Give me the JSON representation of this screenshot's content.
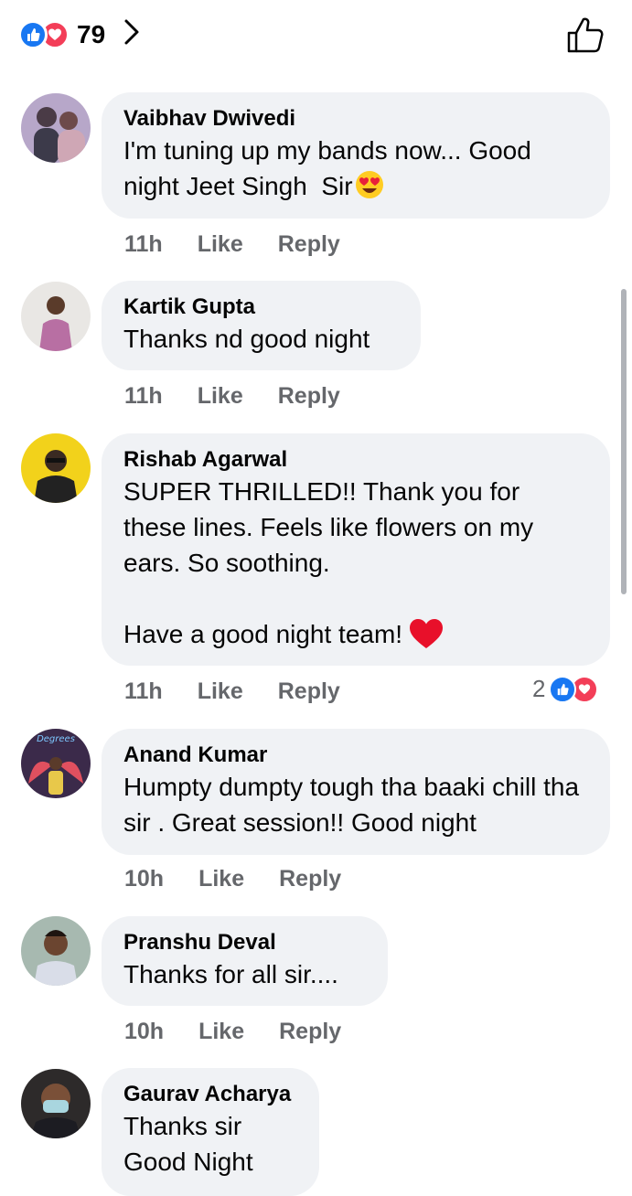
{
  "header": {
    "reaction_count": "79",
    "reaction_icons": [
      "like-icon",
      "love-icon"
    ]
  },
  "comments": [
    {
      "author": "Vaibhav Dwivedi",
      "text": "I'm tuning up my bands now... Good night Jeet Singh  Sir",
      "emoji": "heart-eyes-emoji",
      "time": "11h",
      "like": "Like",
      "reply": "Reply"
    },
    {
      "author": "Kartik Gupta",
      "text": "Thanks nd good night",
      "time": "11h",
      "like": "Like",
      "reply": "Reply"
    },
    {
      "author": "Rishab Agarwal",
      "text": "SUPER THRILLED!! Thank you for these lines. Feels like flowers on my ears. So soothing.\n\nHave a good night team!",
      "emoji": "red-heart-emoji",
      "time": "11h",
      "like": "Like",
      "reply": "Reply",
      "reaction_count": "2"
    },
    {
      "author": "Anand Kumar",
      "text": "Humpty dumpty tough tha baaki chill tha sir . Great session!! Good night",
      "avatar_text": "Degrees",
      "time": "10h",
      "like": "Like",
      "reply": "Reply"
    },
    {
      "author": "Pranshu Deval",
      "text": "Thanks for all sir....",
      "time": "10h",
      "like": "Like",
      "reply": "Reply"
    },
    {
      "author": "Gaurav Acharya",
      "text": "Thanks sir\nGood Night"
    }
  ],
  "colors": {
    "accent": "#1877f2",
    "love": "#f33e58",
    "bubble": "#f0f2f5",
    "meta_text": "#65676b"
  }
}
